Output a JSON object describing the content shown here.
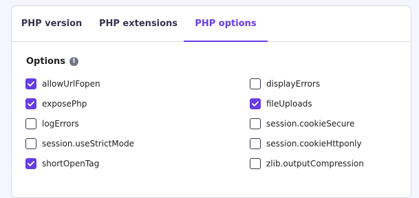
{
  "tabs": [
    {
      "label": "PHP version",
      "active": false
    },
    {
      "label": "PHP extensions",
      "active": false
    },
    {
      "label": "PHP options",
      "active": true
    }
  ],
  "options_section": {
    "title": "Options",
    "info_icon": "info-icon"
  },
  "options_left": [
    {
      "label": "allowUrlFopen",
      "checked": true
    },
    {
      "label": "exposePhp",
      "checked": true
    },
    {
      "label": "logErrors",
      "checked": false
    },
    {
      "label": "session.useStrictMode",
      "checked": false
    },
    {
      "label": "shortOpenTag",
      "checked": true
    }
  ],
  "options_right": [
    {
      "label": "displayErrors",
      "checked": false
    },
    {
      "label": "fileUploads",
      "checked": true
    },
    {
      "label": "session.cookieSecure",
      "checked": false
    },
    {
      "label": "session.cookieHttponly",
      "checked": false
    },
    {
      "label": "zlib.outputCompression",
      "checked": false
    }
  ],
  "colors": {
    "accent": "#673de6",
    "text": "#1d1e20",
    "border": "#dadce0",
    "background": "#f4f5ff"
  }
}
